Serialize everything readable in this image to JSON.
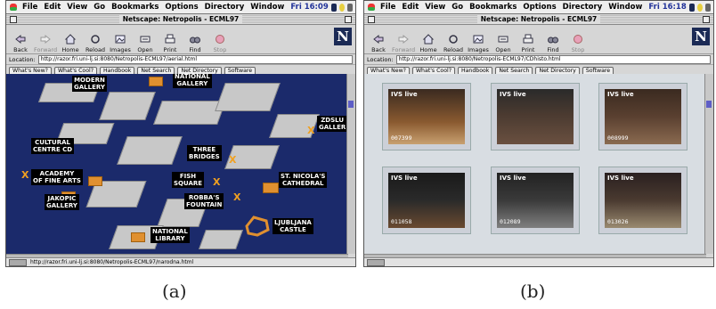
{
  "panels": [
    {
      "menubar": {
        "items": [
          "File",
          "Edit",
          "View",
          "Go",
          "Bookmarks",
          "Options",
          "Directory",
          "Window"
        ],
        "clock": "Fri 16:09"
      },
      "window_title": "Netscape: Netropolis - ECML97",
      "toolbar": [
        "Back",
        "Forward",
        "Home",
        "Reload",
        "Images",
        "Open",
        "Print",
        "Find",
        "Stop"
      ],
      "location_label": "Location:",
      "location_url": "http://razor.fri.uni-lj.si:8080/Netropolis-ECML97/aerial.html",
      "directory_buttons": [
        "What's New?",
        "What's Cool?",
        "Handbook",
        "Net Search",
        "Net Directory",
        "Software"
      ],
      "status_url": "http://razor.fri.uni-lj.si:8080/Netropolis-ECML97/narodna.html",
      "map_labels": [
        "MODERN\nGALLERY",
        "NATIONAL\nGALLERY",
        "ZDSLU\nGALLER",
        "CULTURAL\nCENTRE CD",
        "THREE\nBRIDGES",
        "ACADEMY\nOF FINE ARTS",
        "FISH\nSQUARE",
        "ST. NICOLA'S\nCATHEDRAL",
        "JAKOPIC\nGALLERY",
        "ROBBA'S\nFOUNTAIN",
        "NATIONAL\nLIBRARY",
        "LJUBLJANA\nCASTLE"
      ],
      "caption": "(a)"
    },
    {
      "menubar": {
        "items": [
          "File",
          "Edit",
          "View",
          "Go",
          "Bookmarks",
          "Options",
          "Directory",
          "Window"
        ],
        "clock": "Fri 16:18"
      },
      "window_title": "Netscape: Netropolis - ECML97",
      "toolbar": [
        "Back",
        "Forward",
        "Home",
        "Reload",
        "Images",
        "Open",
        "Print",
        "Find",
        "Stop"
      ],
      "location_label": "Location:",
      "location_url": "http://razor.fri.uni-lj.si:8080/Netropolis-ECML97/CDhisto.html",
      "directory_buttons": [
        "What's New?",
        "What's Cool?",
        "Handbook",
        "Net Search",
        "Net Directory",
        "Software"
      ],
      "thumbnails": [
        {
          "live": "IVS live",
          "num": "007399"
        },
        {
          "live": "IVS live",
          "num": ""
        },
        {
          "live": "IVS live",
          "num": "008999"
        },
        {
          "live": "IVS live",
          "num": "011058"
        },
        {
          "live": "IVS live",
          "num": "012089"
        },
        {
          "live": "IVS live",
          "num": "013026"
        }
      ],
      "caption": "(b)"
    }
  ]
}
